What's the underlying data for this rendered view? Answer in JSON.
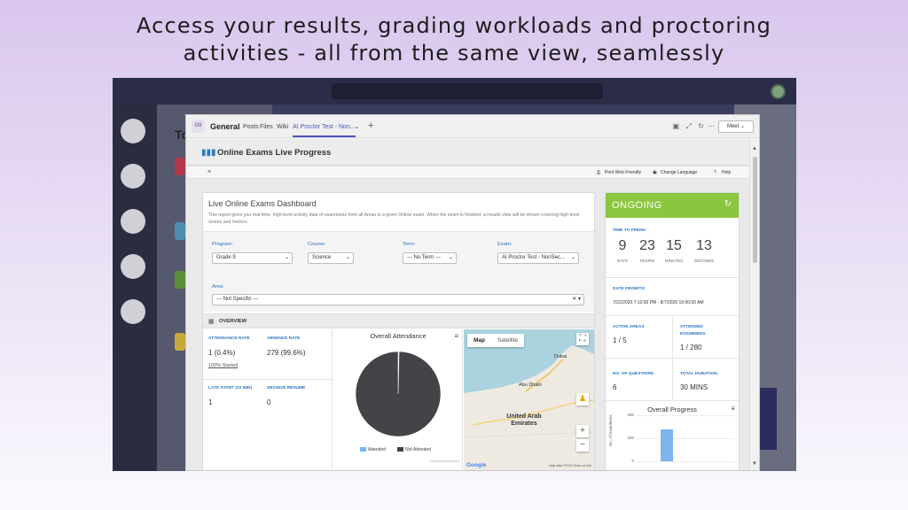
{
  "headline": {
    "line1": "Access your results, grading workloads and proctoring",
    "line2": "activities - all from the same view, seamlessly"
  },
  "teams": {
    "channel_initials": "G9",
    "channel_name": "General",
    "tabs": [
      "Posts",
      "Files",
      "Wiki",
      "AI Proctor Test - Non..."
    ],
    "add_tab": "+",
    "meet_label": "Meet",
    "list_title": "To"
  },
  "page": {
    "title": "Online Exams Live Progress",
    "toolbar": {
      "print": "Print Web Friendly",
      "language": "Change Language",
      "help": "Help"
    }
  },
  "dashboard": {
    "title": "Live Online Exams Dashboard",
    "description": "This report gives you real-time, high-level activity data of examinees from all Areas in a given Online exam. When the exam is finished, a results view will be shown covering high-level scores and metrics.",
    "filters": {
      "program": {
        "label": "Program:",
        "value": "Grade 9"
      },
      "course": {
        "label": "Course:",
        "value": "Science"
      },
      "term": {
        "label": "Term:",
        "value": "--- No Term ---"
      },
      "exam": {
        "label": "Exam:",
        "value": "AI Proctor Test - NonSec..."
      },
      "area": {
        "label": "Area:",
        "value": "--- Not Specific ---"
      }
    },
    "overview_label": "OVERVIEW",
    "stats": {
      "attendance_rate_label": "ATTENDANCE RATE",
      "attendance_rate_value": "1 (0.4%)",
      "absence_rate_label": "ABSENCE RATE",
      "absence_rate_value": "279 (99.6%)",
      "started_link": "100% Started",
      "late_start_label": "LATE START (10 MIN)",
      "late_start_value": "1",
      "session_resume_label": "SESSION RESUME",
      "session_resume_value": "0"
    },
    "attendance_chart_title": "Overall Attendance",
    "chart_credit": "Syncfusion Analytics",
    "map": {
      "tab_map": "Map",
      "tab_satellite": "Satellite",
      "places": [
        "Dubai",
        "Abu Dhabi"
      ],
      "country": "United Arab Emirates",
      "logo": "Google",
      "credit": "Map data ©2020  Terms of Use"
    }
  },
  "side": {
    "status": "ONGOING",
    "time_label": "TIME TO FINISH:",
    "countdown": [
      {
        "value": "9",
        "unit": "DAYS"
      },
      {
        "value": "23",
        "unit": "HOURS"
      },
      {
        "value": "15",
        "unit": "MINUTES"
      },
      {
        "value": "13",
        "unit": "SECONDS"
      }
    ],
    "date_label": "DATE FROM/TO",
    "date_value": "7/22/2020 7:10:00 PM - 8/7/2020 10:00:00 AM",
    "active_areas_label": "ACTIVE AREAS",
    "active_areas_value": "1 / 5",
    "attended_label_1": "ATTENDED",
    "attended_label_2": "EXAMINEES:",
    "attended_value": "1 / 280",
    "questions_label": "NO. OF QUESTIONS",
    "questions_value": "6",
    "duration_label": "TOTAL DURATION",
    "duration_value": "30 MINS",
    "progress_title": "Overall Progress"
  },
  "chart_data": [
    {
      "type": "pie",
      "title": "Overall Attendance",
      "categories": [
        "Attended",
        "Not Attended"
      ],
      "values": [
        1,
        279
      ],
      "colors": [
        "#7cb5ec",
        "#434348"
      ],
      "legend": "bottom"
    },
    {
      "type": "bar",
      "title": "Overall Progress",
      "ylabel": "No. of Examinees",
      "y_ticks": [
        "400",
        "200",
        "0"
      ],
      "ylim": [
        0,
        400
      ],
      "values": [
        280
      ],
      "colors": [
        "#7cb5ec"
      ]
    }
  ],
  "colors": {
    "accent": "#8cc63f",
    "link": "#2a74c4",
    "teams_purple": "#4b53bc"
  }
}
